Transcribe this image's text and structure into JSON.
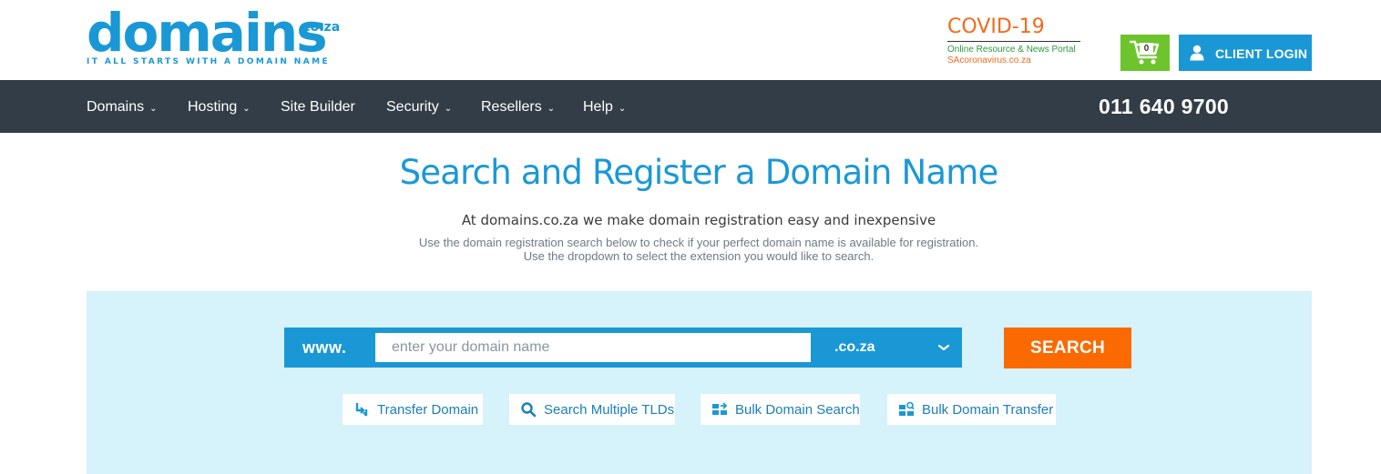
{
  "brand": {
    "logo_main": "domains",
    "logo_suffix": ".co.za",
    "tagline": "IT ALL STARTS WITH A DOMAIN NAME",
    "primary_color": "#1a98d5"
  },
  "covid": {
    "title": "COVID-19",
    "subtitle": "Online Resource & News Portal",
    "url": "SAcoronavirus.co.za"
  },
  "header": {
    "cart_count": "0",
    "login_label": "CLIENT LOGIN"
  },
  "nav": {
    "items": [
      {
        "label": "Domains",
        "dropdown": true
      },
      {
        "label": "Hosting",
        "dropdown": true
      },
      {
        "label": "Site Builder",
        "dropdown": false
      },
      {
        "label": "Security",
        "dropdown": true
      },
      {
        "label": "Resellers",
        "dropdown": true
      },
      {
        "label": "Help",
        "dropdown": true
      }
    ],
    "phone": "011 640 9700"
  },
  "hero": {
    "title": "Search and Register a Domain Name",
    "subtitle": "At domains.co.za we make domain registration easy and inexpensive",
    "desc_line1": "Use the domain registration search below to check if your perfect domain name is available for registration.",
    "desc_line2": "Use the dropdown to select the extension you would like to search."
  },
  "search": {
    "prefix": "www.",
    "input_value": "",
    "placeholder": "enter your domain name",
    "tld_selected": ".co.za",
    "button_label": "SEARCH"
  },
  "options": [
    {
      "label": "Transfer Domain",
      "icon": "transfer-icon"
    },
    {
      "label": "Search Multiple TLDs",
      "icon": "search-icon"
    },
    {
      "label": "Bulk Domain Search",
      "icon": "bulk-search-icon"
    },
    {
      "label": "Bulk Domain Transfer",
      "icon": "bulk-transfer-icon"
    }
  ],
  "colors": {
    "navbar_bg": "#333d47",
    "panel_bg": "#d6f2fb",
    "search_button": "#fb6a00",
    "cart_button": "#6dc42c",
    "covid_orange": "#f36a1b",
    "covid_green": "#2b9a3c"
  }
}
